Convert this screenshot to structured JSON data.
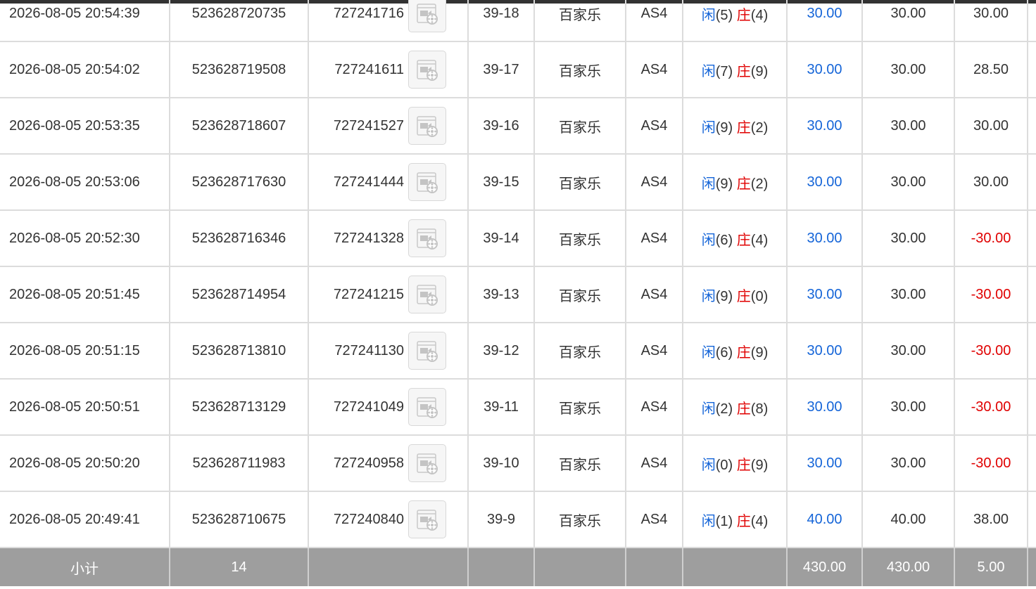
{
  "colors": {
    "player": "#1565d8",
    "banker": "#e00000",
    "negative": "#e00000",
    "subtotal_bg": "#9e9e9e"
  },
  "rows": [
    {
      "time": "2026-08-05 20:54:39",
      "bet_no": "523628720735",
      "round_no": "727241716",
      "shoe": "39-18",
      "game": "百家乐",
      "table": "AS4",
      "player_label": "闲",
      "player_val": "(5)",
      "banker_label": "庄",
      "banker_val": "(4)",
      "bet": "30.00",
      "valid": "30.00",
      "win": "30.00"
    },
    {
      "time": "2026-08-05 20:54:02",
      "bet_no": "523628719508",
      "round_no": "727241611",
      "shoe": "39-17",
      "game": "百家乐",
      "table": "AS4",
      "player_label": "闲",
      "player_val": "(7)",
      "banker_label": "庄",
      "banker_val": "(9)",
      "bet": "30.00",
      "valid": "30.00",
      "win": "28.50"
    },
    {
      "time": "2026-08-05 20:53:35",
      "bet_no": "523628718607",
      "round_no": "727241527",
      "shoe": "39-16",
      "game": "百家乐",
      "table": "AS4",
      "player_label": "闲",
      "player_val": "(9)",
      "banker_label": "庄",
      "banker_val": "(2)",
      "bet": "30.00",
      "valid": "30.00",
      "win": "30.00"
    },
    {
      "time": "2026-08-05 20:53:06",
      "bet_no": "523628717630",
      "round_no": "727241444",
      "shoe": "39-15",
      "game": "百家乐",
      "table": "AS4",
      "player_label": "闲",
      "player_val": "(9)",
      "banker_label": "庄",
      "banker_val": "(2)",
      "bet": "30.00",
      "valid": "30.00",
      "win": "30.00"
    },
    {
      "time": "2026-08-05 20:52:30",
      "bet_no": "523628716346",
      "round_no": "727241328",
      "shoe": "39-14",
      "game": "百家乐",
      "table": "AS4",
      "player_label": "闲",
      "player_val": "(6)",
      "banker_label": "庄",
      "banker_val": "(4)",
      "bet": "30.00",
      "valid": "30.00",
      "win": "-30.00"
    },
    {
      "time": "2026-08-05 20:51:45",
      "bet_no": "523628714954",
      "round_no": "727241215",
      "shoe": "39-13",
      "game": "百家乐",
      "table": "AS4",
      "player_label": "闲",
      "player_val": "(9)",
      "banker_label": "庄",
      "banker_val": "(0)",
      "bet": "30.00",
      "valid": "30.00",
      "win": "-30.00"
    },
    {
      "time": "2026-08-05 20:51:15",
      "bet_no": "523628713810",
      "round_no": "727241130",
      "shoe": "39-12",
      "game": "百家乐",
      "table": "AS4",
      "player_label": "闲",
      "player_val": "(6)",
      "banker_label": "庄",
      "banker_val": "(9)",
      "bet": "30.00",
      "valid": "30.00",
      "win": "-30.00"
    },
    {
      "time": "2026-08-05 20:50:51",
      "bet_no": "523628713129",
      "round_no": "727241049",
      "shoe": "39-11",
      "game": "百家乐",
      "table": "AS4",
      "player_label": "闲",
      "player_val": "(2)",
      "banker_label": "庄",
      "banker_val": "(8)",
      "bet": "30.00",
      "valid": "30.00",
      "win": "-30.00"
    },
    {
      "time": "2026-08-05 20:50:20",
      "bet_no": "523628711983",
      "round_no": "727240958",
      "shoe": "39-10",
      "game": "百家乐",
      "table": "AS4",
      "player_label": "闲",
      "player_val": "(0)",
      "banker_label": "庄",
      "banker_val": "(9)",
      "bet": "30.00",
      "valid": "30.00",
      "win": "-30.00"
    },
    {
      "time": "2026-08-05 20:49:41",
      "bet_no": "523628710675",
      "round_no": "727240840",
      "shoe": "39-9",
      "game": "百家乐",
      "table": "AS4",
      "player_label": "闲",
      "player_val": "(1)",
      "banker_label": "庄",
      "banker_val": "(4)",
      "bet": "40.00",
      "valid": "40.00",
      "win": "38.00"
    }
  ],
  "subtotal": {
    "label": "小计",
    "count": "14",
    "bet": "430.00",
    "valid": "430.00",
    "win": "5.00"
  },
  "icons": {
    "video": "video-replay-icon"
  }
}
